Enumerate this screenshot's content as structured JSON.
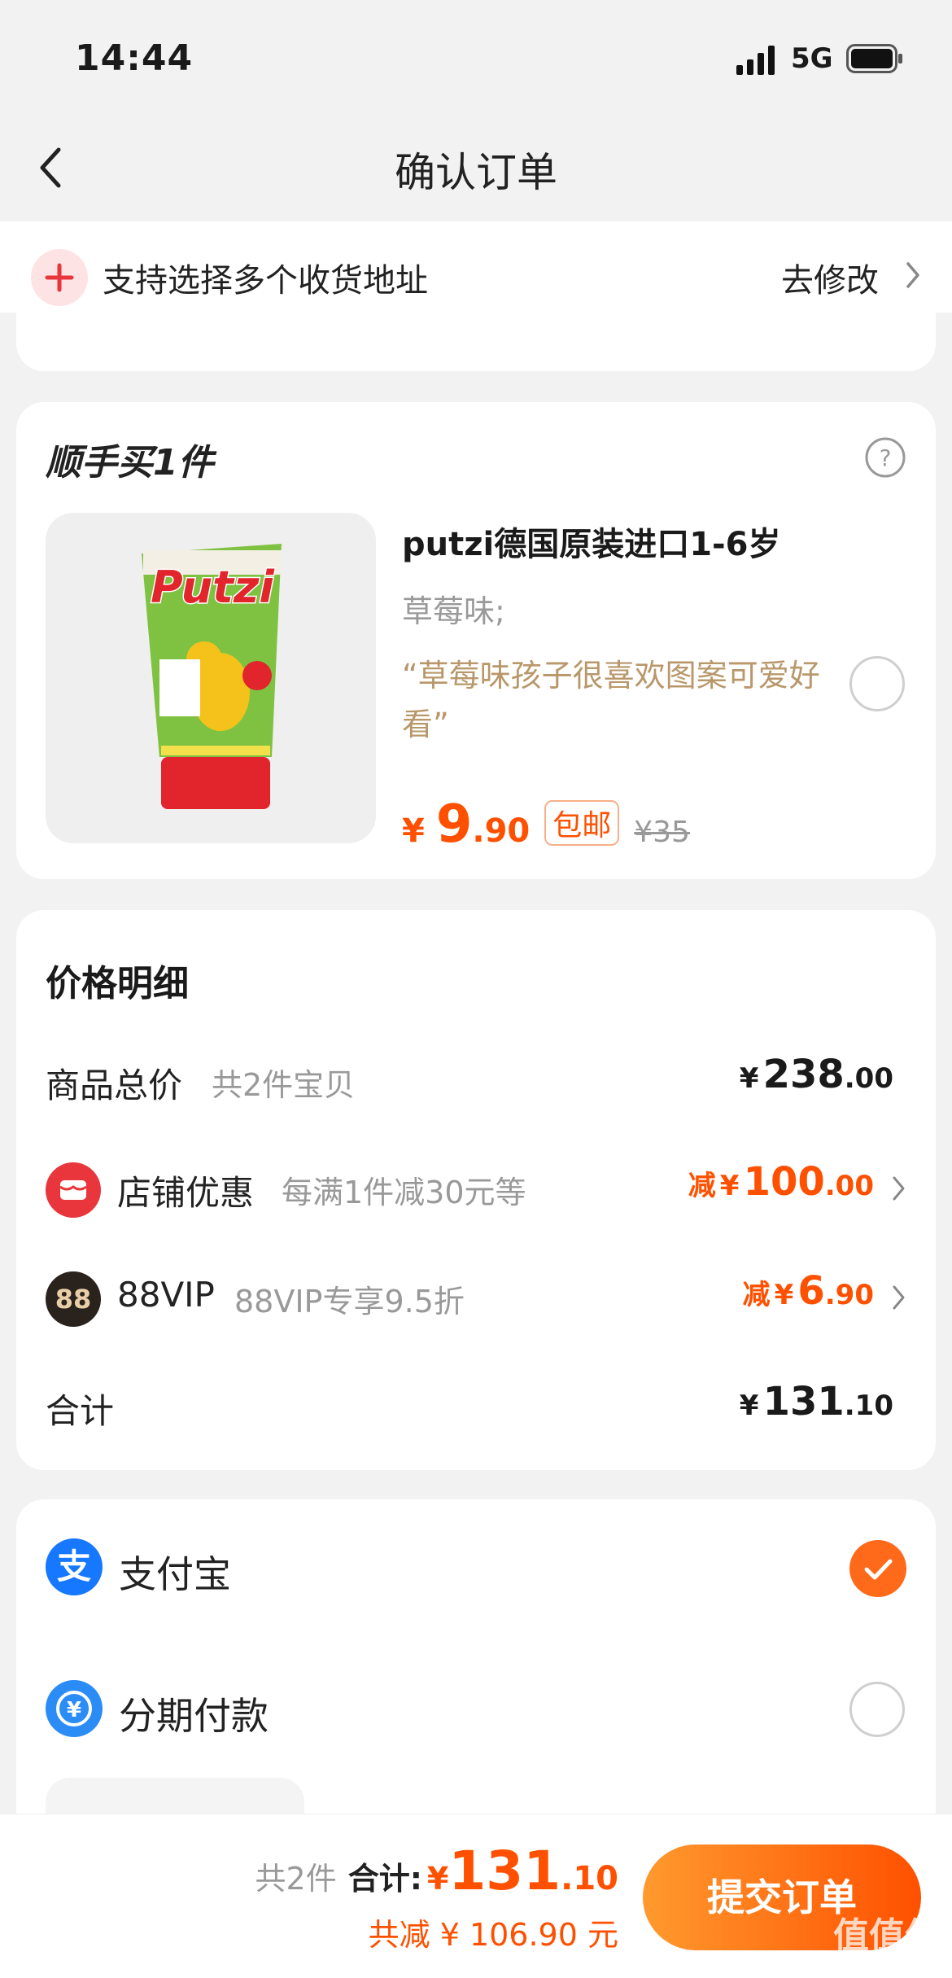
{
  "status_bar": {
    "time": "14:44",
    "network": "5G"
  },
  "nav": {
    "title": "确认订单"
  },
  "address": {
    "text": "支持选择多个收货地址",
    "edit": "去修改"
  },
  "addon": {
    "title": "顺手买1件",
    "product_name": "putzi德国原装进口1-6岁",
    "spec": "草莓味;",
    "review": "“草莓味孩子很喜欢图案可爱好看”",
    "price_yen": "¥",
    "price_int": "9",
    "price_dec": ".90",
    "free_shipping": "包邮",
    "original_price": "¥35",
    "image_brand": "Putzi"
  },
  "price_detail": {
    "title": "价格明细",
    "goods_label": "商品总价",
    "goods_sub": "共2件宝贝",
    "goods_int": "238",
    "goods_dec": ".00",
    "shop_label": "店铺优惠",
    "shop_sub": "每满1件减30元等",
    "shop_prefix": "减",
    "shop_int": "100",
    "shop_dec": ".00",
    "vip_icon": "88",
    "vip_label": "88VIP",
    "vip_sub": "88VIP专享9.5折",
    "vip_prefix": "减",
    "vip_int": "6",
    "vip_dec": ".90",
    "total_label": "合计",
    "total_int": "131",
    "total_dec": ".10",
    "yen": "¥"
  },
  "payment": {
    "alipay_icon": "支",
    "alipay": "支付宝",
    "installment": "分期付款",
    "selected": "alipay"
  },
  "footer": {
    "count": "共2件",
    "sum_label": "合计:",
    "sum_yen": "¥",
    "sum_int": "131",
    "sum_dec": ".10",
    "saved": "共减 ¥ 106.90 元",
    "submit": "提交订单",
    "watermark": "值值值",
    "watermark_url": "zhizhizhi.com"
  },
  "colors": {
    "accent": "#ff5000",
    "review": "#b8976a",
    "alipay": "#1677ff"
  }
}
